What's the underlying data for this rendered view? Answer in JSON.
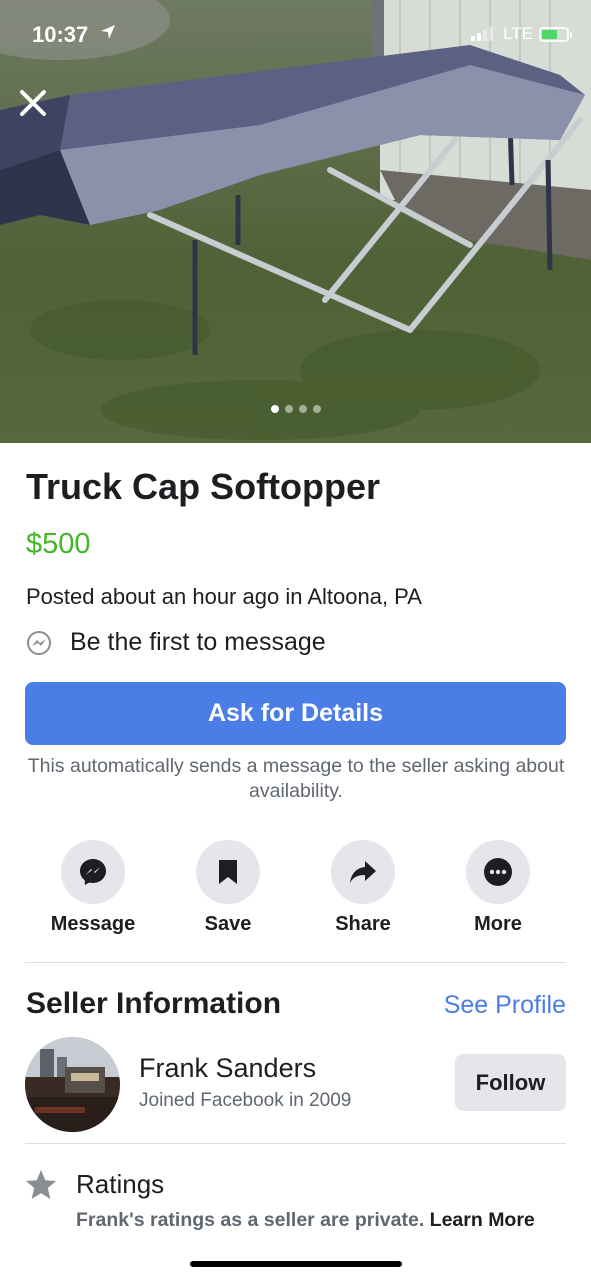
{
  "status_bar": {
    "time": "10:37",
    "network": "LTE",
    "battery_color": "#4cd964"
  },
  "photo": {
    "close_icon": "close-icon",
    "page_count": 4,
    "active_page": 1
  },
  "listing": {
    "title": "Truck Cap Softopper",
    "price": "$500",
    "posted": "Posted about an hour ago in Altoona, PA",
    "first_message": "Be the first to message",
    "ask_button": "Ask for Details",
    "ask_note": "This automatically sends a message to the seller asking about availability."
  },
  "actions": [
    {
      "label": "Message",
      "icon": "messenger-icon"
    },
    {
      "label": "Save",
      "icon": "bookmark-icon"
    },
    {
      "label": "Share",
      "icon": "share-arrow-icon"
    },
    {
      "label": "More",
      "icon": "more-dots-icon"
    }
  ],
  "seller": {
    "header": "Seller Information",
    "see_profile": "See Profile",
    "name": "Frank Sanders",
    "joined": "Joined Facebook in 2009",
    "follow": "Follow"
  },
  "ratings": {
    "title": "Ratings",
    "text": "Frank's ratings as a seller are private.",
    "learn_more": "Learn More"
  },
  "colors": {
    "accent": "#4a7ee6",
    "price": "#42b72a",
    "secondary_text": "#606770"
  }
}
